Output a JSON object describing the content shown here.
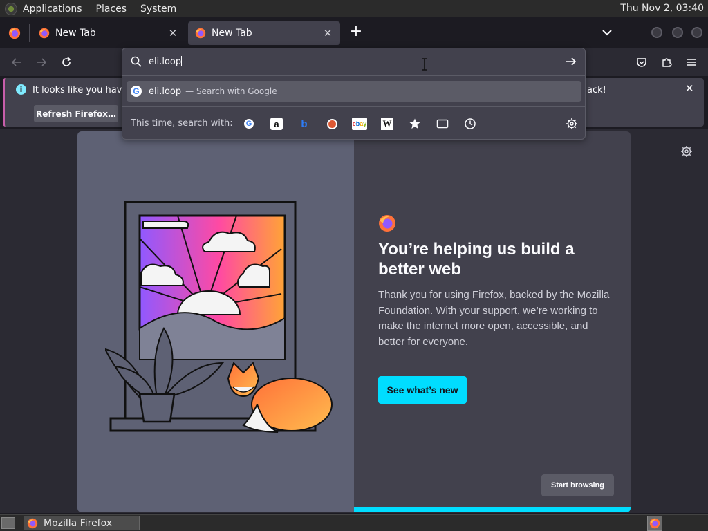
{
  "top_panel": {
    "menus": [
      "Applications",
      "Places",
      "System"
    ],
    "clock": "Thu Nov  2, 03:40"
  },
  "tabs": [
    {
      "label": "New Tab",
      "active": false
    },
    {
      "label": "New Tab",
      "active": true
    }
  ],
  "urlbar": {
    "value": "eli.loop",
    "suggestion": {
      "text": "eli.loop",
      "action": "— Search with Google"
    },
    "oneoff_label": "This time, search with:",
    "engines": [
      "google-icon",
      "amazon-icon",
      "bing-icon",
      "duckduckgo-icon",
      "ebay-icon",
      "wikipedia-icon",
      "bookmarks-icon",
      "tabs-icon",
      "history-icon"
    ]
  },
  "notification": {
    "text_start": "It looks like you haven't",
    "text_end": "ack!",
    "button": "Refresh Firefox…"
  },
  "welcome": {
    "title": "You’re helping us build a better web",
    "body": "Thank you for using Firefox, backed by the Mozilla Foundation. With your support, we’re working to make the internet more open, accessible, and better for everyone.",
    "cta": "See what’s new",
    "secondary": "Start browsing"
  },
  "taskbar": {
    "window_title": "Mozilla Firefox"
  },
  "colors": {
    "accent": "#00ddff",
    "panel": "#42414d",
    "toolbar": "#2b2a33",
    "illustration_panel": "#5e6174"
  }
}
